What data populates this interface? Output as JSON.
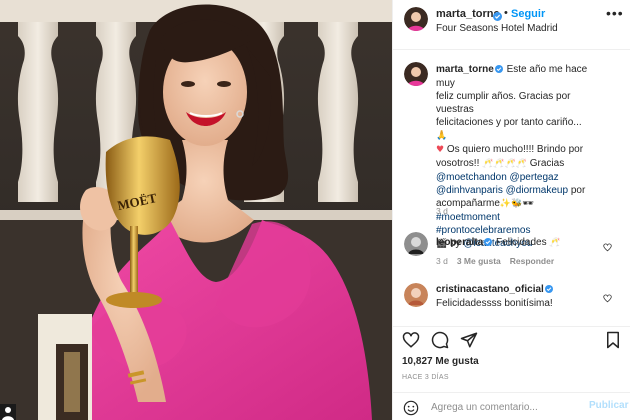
{
  "post": {
    "username": "marta_torne",
    "follow_label": "Seguir",
    "location": "Four Seasons Hotel Madrid",
    "more_label": "•••",
    "caption": {
      "username": "marta_torne",
      "line1": "Este año me hace muy",
      "line2": "feliz cumplir años. Gracias por vuestras",
      "line3": "felicitaciones y por tanto cariño...",
      "line4": "Os quiero mucho!!!! Brindo por",
      "line5a": "vosotros!!",
      "line5b": "Gracias",
      "mention1": "@moetchandon",
      "mention2": "@pertegaz",
      "mention3": "@dinhvanparis",
      "mention4": "@diormakeup",
      "line7tail": "por",
      "line8": "acompañarme",
      "hashtag1": "#moetmoment",
      "hashtag2": "#prontocelebraremos",
      "by_label": "by",
      "mention5": "@icanteachyou",
      "time": "3 d"
    },
    "comments": [
      {
        "username": "leoperalta",
        "text": "Felicidades",
        "time": "3 d",
        "likes": "3 Me gusta",
        "reply": "Responder"
      },
      {
        "username": "cristinacastano_oficial",
        "text": "Felicidadessss bonitísima!"
      }
    ],
    "likes_count": "10,827 Me gusta",
    "posted_ago": "HACE 3 DÍAS",
    "comment_placeholder": "Agrega un comentario...",
    "post_label": "Publicar",
    "photo_text": "MOËT"
  },
  "colors": {
    "accent": "#0095f6",
    "mention": "#00376b",
    "dress": "#e8389a",
    "gold": "#c9962a"
  },
  "icons": [
    "verified-icon",
    "more-icon",
    "heart-icon",
    "comment-icon",
    "share-icon",
    "bookmark-icon",
    "emoji-icon"
  ]
}
